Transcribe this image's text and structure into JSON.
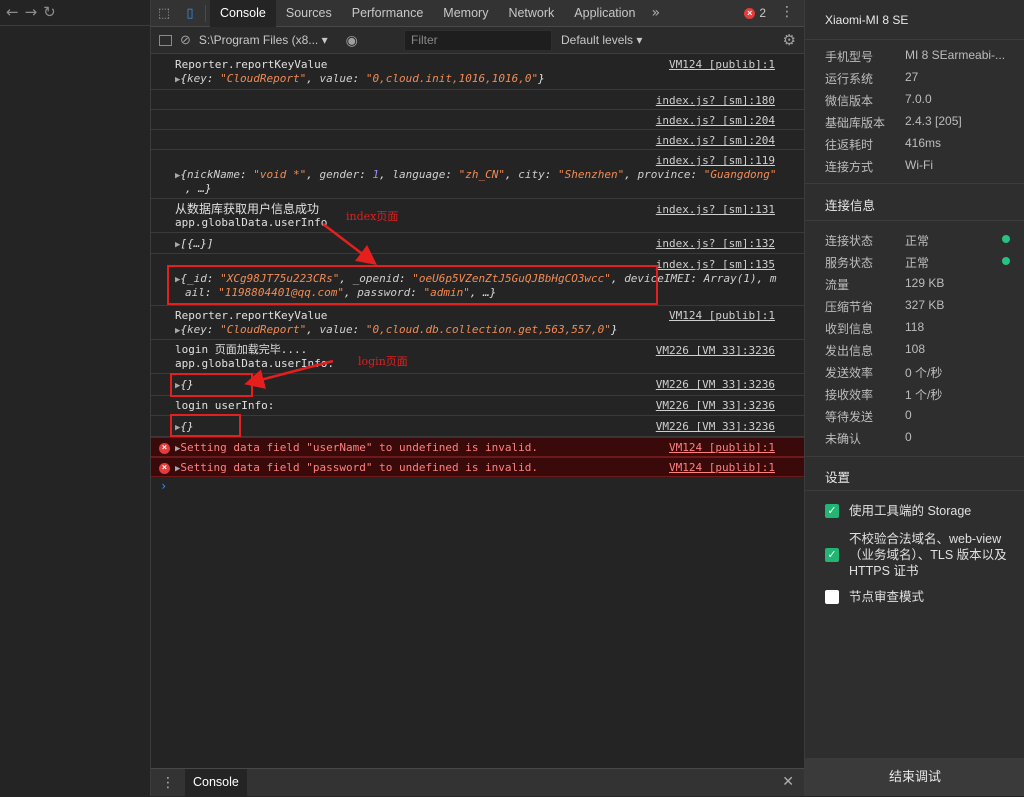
{
  "devtools": {
    "tabs": [
      "Console",
      "Sources",
      "Performance",
      "Memory",
      "Network",
      "Application"
    ],
    "error_count": "2",
    "context": "S:\\Program Files (x8...",
    "filter_placeholder": "Filter",
    "levels": "Default levels"
  },
  "console": {
    "rows": [
      {
        "src": "VM124 [publib]:1",
        "line1": "Reporter.reportKeyValue"
      },
      {
        "src": "index.js? [sm]:180"
      },
      {
        "src": "index.js? [sm]:204"
      },
      {
        "src": "index.js? [sm]:204"
      },
      {
        "src": "index.js? [sm]:119"
      },
      {
        "src": "index.js? [sm]:131",
        "line1": "从数据库获取用户信息成功",
        "line2": "app.globalData.userInfo"
      },
      {
        "src": "index.js? [sm]:132",
        "line1": "[{…}]"
      },
      {
        "src": "index.js? [sm]:135"
      },
      {
        "src": "VM124 [publib]:1",
        "line1": "Reporter.reportKeyValue"
      },
      {
        "src": "VM226 [VM 33]:3236",
        "line1": "login 页面加载完毕....",
        "line2": "app.globalData.userInfo:"
      },
      {
        "src": "VM226 [VM 33]:3236",
        "line1": "{}"
      },
      {
        "src": "VM226 [VM 33]:3236",
        "line1": "login userInfo:"
      },
      {
        "src": "VM226 [VM 33]:3236",
        "line1": "{}"
      }
    ],
    "errors": [
      {
        "src": "VM124 [publib]:1",
        "text": "Setting data field \"userName\" to undefined is invalid."
      },
      {
        "src": "VM124 [publib]:1",
        "text": "Setting data field \"password\" to undefined is invalid."
      }
    ],
    "obj_cloudinit": {
      "k1": "key",
      "v1": "\"CloudReport\"",
      "k2": "value",
      "v2": "\"0,cloud.init,1016,1016,0\""
    },
    "obj_user": {
      "k1": "nickName",
      "v1": "\"void *\"",
      "k2": "gender",
      "v2": "1",
      "k3": "language",
      "v3": "\"zh_CN\"",
      "k4": "city",
      "v4": "\"Shenzhen\"",
      "k5": "province",
      "v5": "\"Guangdong\"",
      "tail": ", …}"
    },
    "obj_db": {
      "k1": "_id",
      "v1": "\"XCg98JT75u223CRs\"",
      "k2": "_openid",
      "v2": "\"oeU6p5VZenZtJ5GuQJBbHgCO3wcc\"",
      "k3": "deviceIMEI",
      "v3": "Array(1)",
      "k4a": "m",
      "k4b": "ail",
      "v4": "\"1198804401@qq.com\"",
      "k5": "password",
      "v5": "\"admin\"",
      "tail": ", …}"
    },
    "obj_clouddb": {
      "k1": "key",
      "v1": "\"CloudReport\"",
      "k2": "value",
      "v2": "\"0,cloud.db.collection.get,563,557,0\""
    },
    "annotations": {
      "index": "index页面",
      "login": "login页面"
    }
  },
  "drawer": {
    "tab": "Console"
  },
  "sidebar": {
    "device": "Xiaomi-MI 8 SE",
    "info": [
      {
        "k": "手机型号",
        "v": "MI 8 SEarmeabi-..."
      },
      {
        "k": "运行系统",
        "v": "27"
      },
      {
        "k": "微信版本",
        "v": "7.0.0"
      },
      {
        "k": "基础库版本",
        "v": "2.4.3 [205]"
      },
      {
        "k": "往返耗时",
        "v": "416ms"
      },
      {
        "k": "连接方式",
        "v": "Wi-Fi"
      }
    ],
    "conn_title": "连接信息",
    "conn": [
      {
        "k": "连接状态",
        "v": "正常"
      },
      {
        "k": "服务状态",
        "v": "正常"
      },
      {
        "k": "流量",
        "v": "129 KB"
      },
      {
        "k": "压缩节省",
        "v": "327 KB"
      },
      {
        "k": "收到信息",
        "v": "118"
      },
      {
        "k": "发出信息",
        "v": "108"
      },
      {
        "k": "发送效率",
        "v": "0 个/秒"
      },
      {
        "k": "接收效率",
        "v": "1 个/秒"
      },
      {
        "k": "等待发送",
        "v": "0"
      },
      {
        "k": "未确认",
        "v": "0"
      }
    ],
    "settings_title": "设置",
    "settings": [
      {
        "label": "使用工具端的 Storage"
      },
      {
        "label": "不校验合法域名、web-view（业务域名）、TLS 版本以及 HTTPS 证书"
      },
      {
        "label": "节点审查模式"
      }
    ],
    "end_button": "结束调试",
    "status_color": "#26c281"
  }
}
